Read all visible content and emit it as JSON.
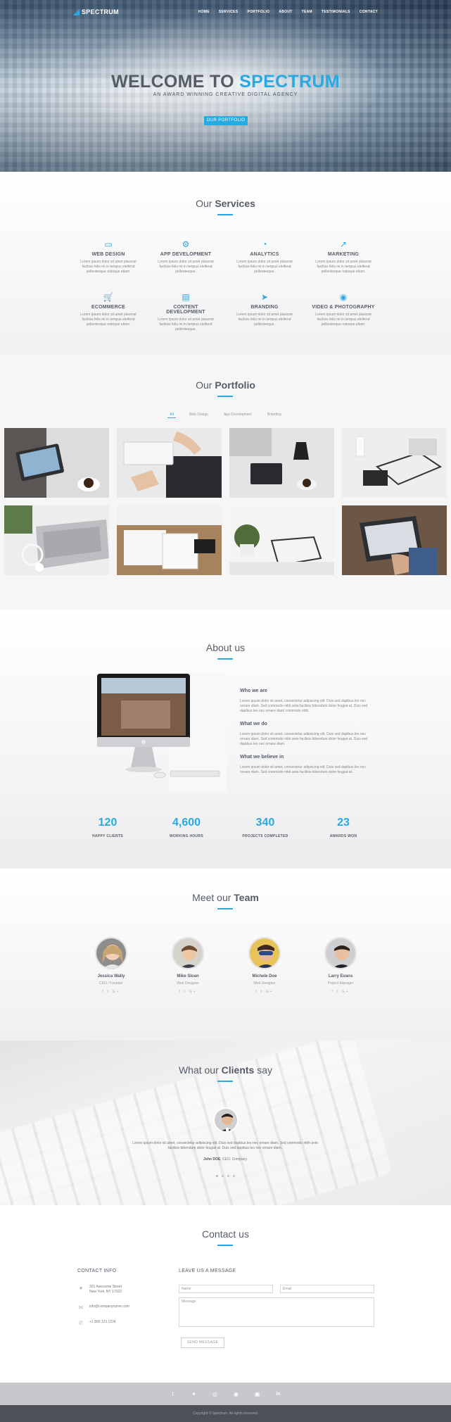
{
  "colors": {
    "accent": "#29a9e1",
    "heading": "#555c66",
    "footer_dark": "#4e5058",
    "footer_light": "#c8c8cc"
  },
  "header": {
    "brand": "SPECTRUM",
    "nav": [
      "HOME",
      "SERVICES",
      "PORTFOLIO",
      "ABOUT",
      "TEAM",
      "TESTIMONIALS",
      "CONTACT"
    ]
  },
  "hero": {
    "title_prefix": "WELCOME TO",
    "title_highlight": "SPECTRUM",
    "subtitle": "AN AWARD WINNING CREATIVE DIGITAL AGENCY",
    "button": "OUR PORTFOLIO"
  },
  "services": {
    "title_prefix": "Our",
    "title_bold": "Services",
    "items": [
      {
        "icon": "monitor-icon",
        "name": "WEB DESIGN",
        "desc": "Lorem ipsum dolor sit amet placerat facilisis felis mi in tempus eleifend pellentesque natoque etiam."
      },
      {
        "icon": "gears-icon",
        "name": "APP DEVELOPMENT",
        "desc": "Lorem ipsum dolor sit amet placerat facilisis felis mi in tempus eleifend pellentesque."
      },
      {
        "icon": "pie-chart-icon",
        "name": "ANALYTICS",
        "desc": "Lorem ipsum dolor sit amet placerat facilisis felis mi in tempus eleifend pellentesque."
      },
      {
        "icon": "line-chart-icon",
        "name": "MARKETING",
        "desc": "Lorem ipsum dolor sit amet placerat facilisis felis mi in tempus eleifend pellentesque natoque etiam."
      },
      {
        "icon": "cart-icon",
        "name": "ECOMMERCE",
        "desc": "Lorem ipsum dolor sit amet placerat facilisis felis mi in tempus eleifend pellentesque natoque etiam."
      },
      {
        "icon": "document-icon",
        "name": "CONTENT DEVELOPMENT",
        "desc": "Lorem ipsum dolor sit amet placerat facilisis felis mi in tempus eleifend pellentesque."
      },
      {
        "icon": "rocket-icon",
        "name": "BRANDING",
        "desc": "Lorem ipsum dolor sit amet placerat facilisis felis mi in tempus eleifend pellentesque."
      },
      {
        "icon": "camera-icon",
        "name": "VIDEO & PHOTOGRAPHY",
        "desc": "Lorem ipsum dolor sit amet placerat facilisis felis mi in tempus eleifend pellentesque natoque etiam."
      }
    ]
  },
  "portfolio": {
    "title_prefix": "Our",
    "title_bold": "Portfolio",
    "filters": [
      "All",
      "Web Design",
      "App Development",
      "Branding"
    ],
    "active_filter": "All"
  },
  "about": {
    "title": "About us",
    "blocks": [
      {
        "heading": "Who we are",
        "text": "Lorem ipsum dolor sit amet, consectetur adipiscing elit. Duis sed dapibus leo nec ornare diam. Sed commodo nibh ante facilisis bibendum dolor feugiat at. Duis sed dapibus leo nec ornare diam commodo nibh."
      },
      {
        "heading": "What we do",
        "text": "Lorem ipsum dolor sit amet, consectetur adipiscing elit. Duis sed dapibus leo nec ornare diam. Sed commodo nibh ante facilisis bibendum dolor feugiat at. Duis sed dapibus leo nec ornare diam."
      },
      {
        "heading": "What we believe in",
        "text": "Lorem ipsum dolor sit amet, consectetur adipiscing elit. Duis sed dapibus leo nec ornare diam. Sed commodo nibh ante facilisis bibendum dolor feugiat at."
      }
    ],
    "stats": [
      {
        "value": "120",
        "label": "HAPPY CLIENTS"
      },
      {
        "value": "4,600",
        "label": "WORKING HOURS"
      },
      {
        "value": "340",
        "label": "PROJECTS COMPLETED"
      },
      {
        "value": "23",
        "label": "AWARDS WON"
      }
    ]
  },
  "team": {
    "title_prefix": "Meet our",
    "title_bold": "Team",
    "social": "f  𝕥  G+",
    "members": [
      {
        "name": "Jessica Wally",
        "role": "CEO / Founder"
      },
      {
        "name": "Mike Sloan",
        "role": "Web Designer"
      },
      {
        "name": "Michele Doe",
        "role": "Web Designer"
      },
      {
        "name": "Larry Evans",
        "role": "Project Manager"
      }
    ]
  },
  "testimonials": {
    "title_prefix": "What our",
    "title_bold": "Clients",
    "title_suffix": "say",
    "quote": "Lorem ipsum dolor sit amet, consectetur adipiscing elit. Duis sed dapibus leo nec ornare diam. Sed commodo nibh ante facilisis bibendum dolor feugiat at. Duis sed dapibus leo nec ornare diam.",
    "author": "John DOE",
    "author_suffix": ", CEO, Company."
  },
  "contact": {
    "title": "Contact us",
    "info_heading": "CONTACT INFO",
    "address": [
      "321 Awesome Street",
      "New York, NY 17022"
    ],
    "email": "info@companyname.com",
    "phone": "+1 800 123 1234",
    "form_heading": "LEAVE US A MESSAGE",
    "name_placeholder": "Name",
    "email_placeholder": "Email",
    "message_placeholder": "Message",
    "send": "SEND MESSAGE"
  },
  "footer": {
    "social_icons": [
      "facebook-icon",
      "twitter-icon",
      "dribbble-icon",
      "github-icon",
      "instagram-icon",
      "linkedin-icon"
    ],
    "copyright": "Copyright © Spectrum. All rights reserved."
  }
}
